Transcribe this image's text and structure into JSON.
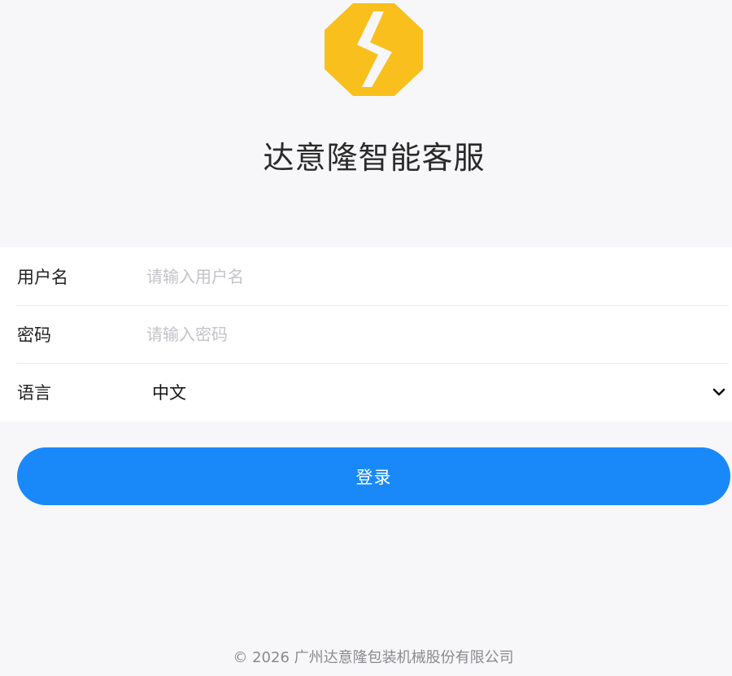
{
  "brand": {
    "logo_icon": "lightning-octagon-icon",
    "logo_color": "#f9bf1d",
    "title": "达意隆智能客服"
  },
  "form": {
    "username": {
      "label": "用户名",
      "value": "",
      "placeholder": "请输入用户名"
    },
    "password": {
      "label": "密码",
      "value": "",
      "placeholder": "请输入密码"
    },
    "language": {
      "label": "语言",
      "selected": "中文",
      "icon": "chevron-down-icon"
    }
  },
  "login_button": {
    "label": "登录",
    "color": "#1989fa"
  },
  "footer": {
    "copyright": "© 2026 广州达意隆包装机械股份有限公司"
  }
}
